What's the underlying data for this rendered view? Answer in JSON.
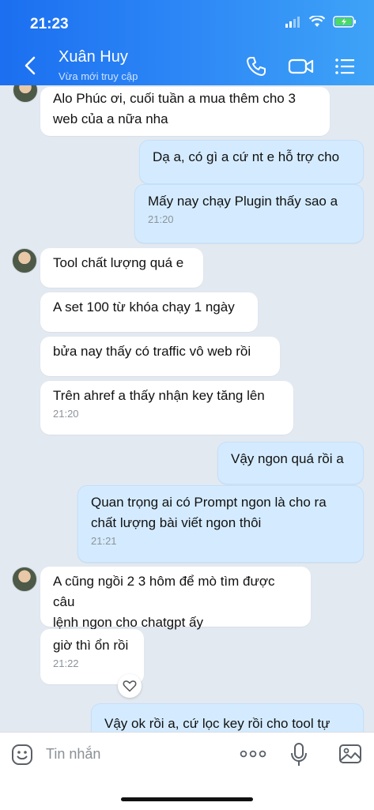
{
  "status_bar": {
    "time": "21:23"
  },
  "header": {
    "name": "Xuân Huy",
    "status": "Vừa mới truy cập",
    "icons": [
      "back-arrow-icon",
      "phone-icon",
      "video-call-icon",
      "menu-icon"
    ]
  },
  "messages": [
    {
      "from": "in",
      "text_lines": [
        "Alo Phúc ơi, cuối tuần a mua thêm cho 3",
        "web của a nữa nha"
      ]
    },
    {
      "from": "out",
      "text_lines": [
        "Dạ a, có gì a cứ nt e hỗ trợ cho"
      ]
    },
    {
      "from": "out",
      "text_lines": [
        "Mấy nay chạy Plugin thấy sao a"
      ],
      "time": "21:20"
    },
    {
      "from": "in",
      "text_lines": [
        "Tool chất lượng quá e"
      ]
    },
    {
      "from": "in",
      "text_lines": [
        "A set 100 từ khóa chạy 1 ngày"
      ]
    },
    {
      "from": "in",
      "text_lines": [
        "bửa nay thấy có traffic vô web rồi"
      ]
    },
    {
      "from": "in",
      "text_lines": [
        "Trên ahref a thấy nhận key tăng lên"
      ],
      "time": "21:20"
    },
    {
      "from": "out",
      "text_lines": [
        "Vậy ngon quá rồi a"
      ]
    },
    {
      "from": "out",
      "text_lines": [
        "Quan trọng ai có Prompt ngon là cho ra",
        "chất lượng bài viết ngon thôi"
      ],
      "time": "21:21"
    },
    {
      "from": "in",
      "text_lines": [
        "A cũng ngồi 2 3 hôm để mò tìm được câu",
        "lệnh ngon cho chatgpt ấy"
      ]
    },
    {
      "from": "in",
      "text_lines": [
        "giờ thì ổn rồi"
      ],
      "time": "21:22"
    },
    {
      "from": "out",
      "text_lines": [
        "Vậy ok rồi a, cứ lọc key rồi cho tool tự"
      ]
    }
  ],
  "composer": {
    "placeholder": "Tin nhắn",
    "icons": [
      "sticker-icon",
      "more-icon",
      "microphone-icon",
      "image-icon"
    ]
  }
}
